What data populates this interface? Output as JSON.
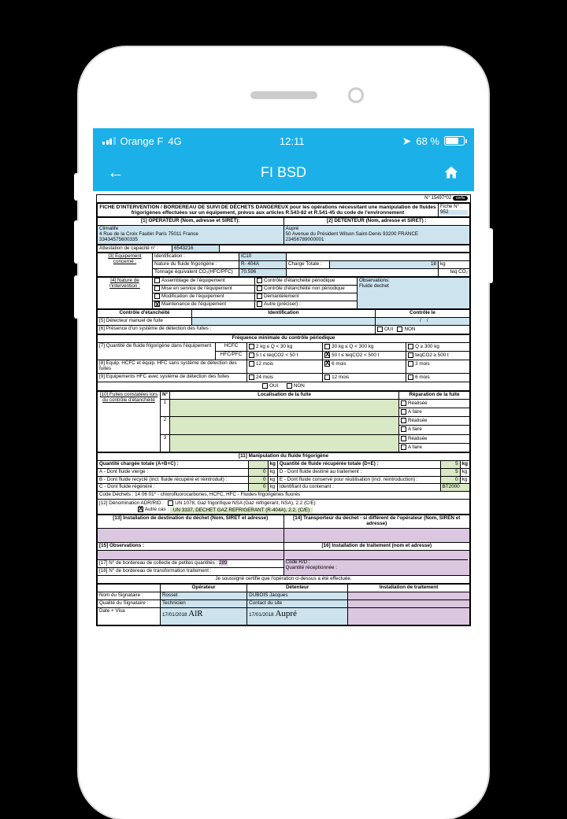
{
  "status": {
    "carrier": "Orange F",
    "network": "4G",
    "time": "12:11",
    "battery": "68 %"
  },
  "nav": {
    "title": "FI BSD"
  },
  "doc": {
    "topnum": "N° 15497*02",
    "header": "FICHE D'INTERVENTION / BORDEREAU DE SUIVI DE DÉCHETS DANGEREUX pour les opérations nécessitant une manipulation de fluides frigorigènes effectuées sur un équipement, prévus aux articles R.543-82 et R.541-45 du code de l'environnement",
    "fiche_label": "Fiche N° :",
    "fiche_num": "952",
    "op_label": "[1] OPERATEUR (Nom, adresse et SIRET):",
    "op_name": "Climalife",
    "op_addr": "4 Rue de la Croix Faubin Paris 75011 France",
    "op_siret": "33434575600335",
    "att_label": "Attestation de capacité n° :",
    "att_num": "6543216",
    "det_label": "[2] DETENTEUR  (Nom, adresse et SIRET) :",
    "det_name": "Aupré",
    "det_addr": "50 Avenue du Président Wilson Saint-Denis 93200 FRANCE",
    "det_siret": "23456789000001",
    "eq_label": "[3] Equipement concerné :",
    "eq_ident_lab": "Identification :",
    "eq_ident": "IC10",
    "eq_nature_lab": "Nature du fluide frigorigène :",
    "eq_nature": "R- 404A",
    "eq_charge_lab": "Charge Totale :",
    "eq_charge_val": "18",
    "eq_charge_unit": "kg",
    "eq_ton_lab": "Tonnage équivalent CO₂(HFC/PFC)",
    "eq_ton": "70.596",
    "eq_ton_unit": "teq CO₂",
    "nat_label": "[4] Nature de l'intervention :",
    "nat_obs_lab": "Observations:",
    "nat_obs": "Fluide dechet",
    "n_assem": "Assemblage de l'équipement",
    "n_mes": "Mise en service de l'équipement",
    "n_modif": "Modification de l'équipement",
    "n_maint": "Maintenance de l'équipement",
    "n_cep": "Contrôle d'étanchéité périodique",
    "n_cenp": "Contrôle d'étanchéité non périodique",
    "n_dem": "Démantèlement",
    "n_autre": "Autre (préciser) :",
    "ctrl_label": "Contrôle d'étanchéité",
    "ctrl_ident": "Identification",
    "ctrl_le": "Contrôle le",
    "r5": "[5] Détecteur manuel de fuite",
    "r6": "[6] Présence d'un système de détection des fuites :",
    "oui": "OUI",
    "non": "NON",
    "freq_label": "Fréquence minimale du contrôle périodique",
    "r7": "[7] Quantité de fluide frigorigène dans l'équipement",
    "hcfc": "HCFC",
    "hfcpfc": "HFC/PFC",
    "f7a": "2 kg ≤  Q < 30 kg",
    "f7b": "30 kg ≤ Q < 300 kg",
    "f7c": "Q  ≥ 300 kg",
    "f7d": "5 t ≤ teqCO2 < 50 t",
    "f7e": "50 t ≤ teqCO2 < 500 t",
    "f7f": "teqCO2 ≥ 500 t",
    "r8": "[8] Equip. HCFC et équip. HFC sans système de détection des fuites",
    "m12": "12 mois",
    "m6": "6 mois",
    "m3": "3 mois",
    "m24": "24 mois",
    "r9": "[9] Equipements HFC avec système de détection des fuites",
    "r10": "[10] Fuites constatées lors du contrôle d'étanchéité",
    "r10_n": "N°",
    "r10_loc": "Localisation de la fuite",
    "r10_rep": "Réparation de la fuite",
    "real": "Réalisée",
    "afaire": "A faire",
    "r11": "[11] Manipulation du fluide frigorigène",
    "qc_lab": "Quantité chargée totale (A+B+C) :",
    "kg": "kg",
    "qr_lab": "Quantité de fluide récupérée totale (D+E) :",
    "qr_val": "5",
    "la": "A - Dont fluide vierge :",
    "la_v": "0",
    "lb": "B - Dont fluide recyclé (incl. fluide récupéré et réintroduit) :",
    "lb_v": "0",
    "lc": "C - Dont fluide régénéré :",
    "lc_v": "0",
    "ld": "D - Dont fluide destiné au traitement :",
    "ld_v": "5",
    "le": "E - Dont fluide conservé pour réutilisation (incl. réintroduction) :",
    "le_v": "0",
    "lid": "Identifiant du contenant :",
    "lid_v": "BT2000",
    "code_dech": "Code Déchets : 14 06 01* - chlorofluorocarbones, HCFC, HFC - Fluides frigorigènes fluorés",
    "r12": "[12] Dénomination ADR/RID :",
    "adr_opt1": "UN 1078, Gaz frigorifique NSA (Gaz réfrigérant, NSA), 2.2 (C/E)",
    "adr_opt2_lab": "Autre cas :",
    "adr_opt2": "UN 3337, DECHET GAZ REFRIGERANT (R-404A), 2.2, (C/E)",
    "r13": "[13] Installation de destination du déchet (Nom, SIRET et adresse)",
    "r14": "[14] Transporteur du déchet - si différent de l'opérateur (Nom, SIREN et adresse)",
    "r15": "[15] Observations :",
    "r16": "[16] Installation de traitement (nom et adresse)",
    "r17": "[17] N° de bordereau de collecte de petites quantités :",
    "r17_v": "289",
    "r18": "[18] N° de bordereau de transformation traitement :",
    "code_rd": "Code R/D :",
    "qrecep": "Quantité réceptionnée :",
    "cert": "Je soussigné certifie que l'opération ci-dessus a été effectuée.",
    "col_op": "Opérateur",
    "col_det": "Détenteur",
    "col_inst": "Installation de traitement",
    "row_nom": "Nom du Signataire :",
    "row_qual": "Qualité du Signataire :",
    "row_date": "Date + Visa",
    "op_sig_nom": "Rosset",
    "op_sig_qual": "Technicien",
    "op_sig_date": "17/01/2018",
    "op_sig": "AlR",
    "det_sig_nom": "DUBOIS Jacques",
    "det_sig_qual": "Contact du site",
    "det_sig_date": "17/01/2018",
    "det_sig": "Aupré"
  }
}
